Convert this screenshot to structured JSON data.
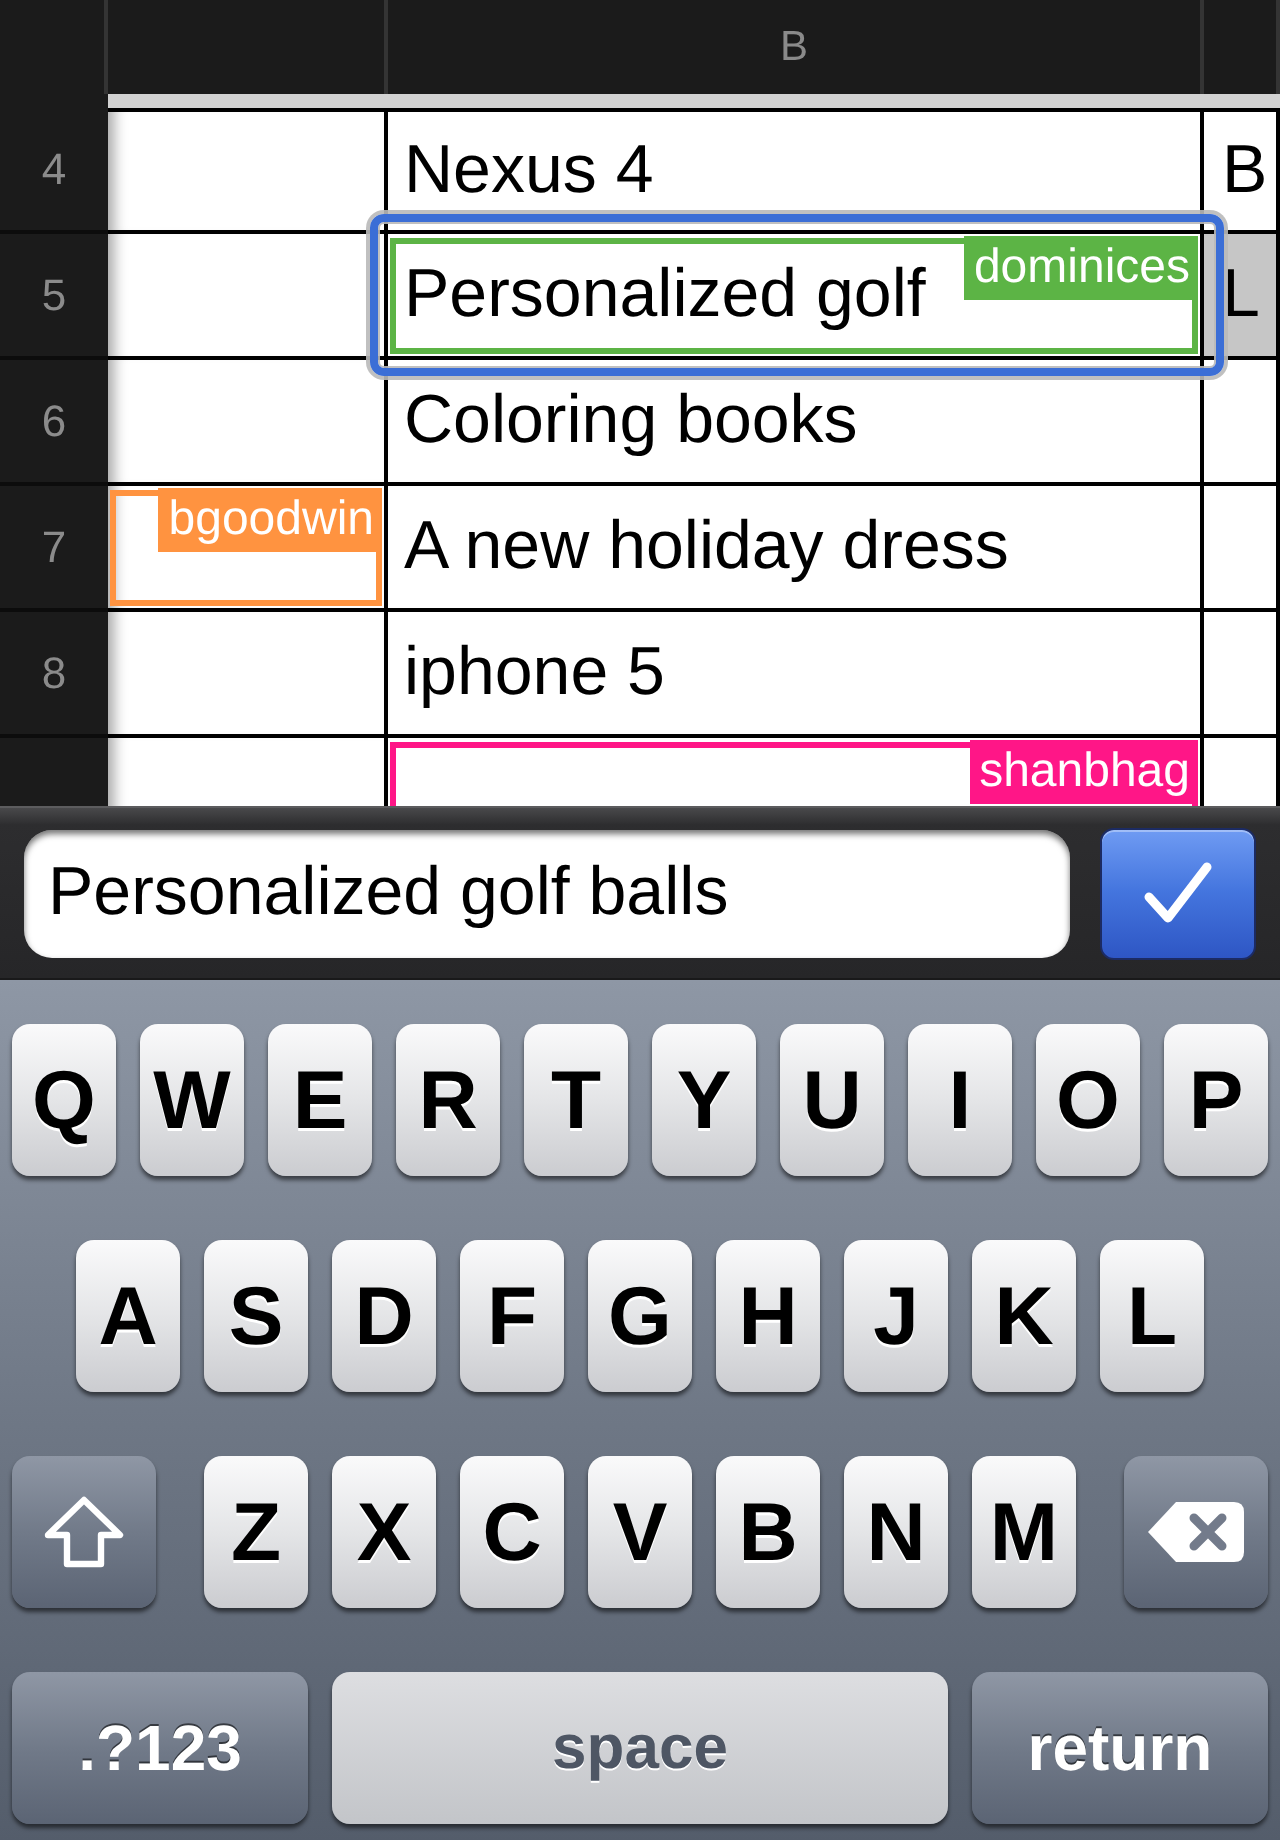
{
  "sheet": {
    "columns": [
      {},
      {
        "label": "B"
      },
      {}
    ],
    "rows": [
      {
        "number": "4",
        "cells": [
          {
            "selected": false,
            "shaded": false
          },
          {
            "text": "Nexus 4",
            "selected": false,
            "shaded": false
          },
          {
            "text": "B",
            "selected": false,
            "shaded": false
          }
        ]
      },
      {
        "number": "5",
        "cells": [
          {
            "selected": false,
            "shaded": false
          },
          {
            "text": "Personalized golf",
            "selected": true,
            "shaded": false,
            "collaborator": {
              "name": "dominices",
              "color": "#5cb445"
            }
          },
          {
            "text": "L",
            "selected": false,
            "shaded": true
          }
        ]
      },
      {
        "number": "6",
        "cells": [
          {
            "selected": false,
            "shaded": false
          },
          {
            "text": "Coloring books",
            "selected": false,
            "shaded": false
          },
          {
            "selected": false,
            "shaded": false
          }
        ]
      },
      {
        "number": "7",
        "cells": [
          {
            "selected": false,
            "shaded": false,
            "collaborator": {
              "name": "bgoodwin",
              "color": "#ff9340"
            }
          },
          {
            "text": "A new holiday dress",
            "selected": false,
            "shaded": false
          },
          {
            "selected": false,
            "shaded": false
          }
        ]
      },
      {
        "number": "8",
        "cells": [
          {
            "selected": false,
            "shaded": false
          },
          {
            "text": "iphone 5",
            "selected": false,
            "shaded": false
          },
          {
            "selected": false,
            "shaded": false
          }
        ]
      },
      {
        "cells": [
          {
            "selected": false,
            "shaded": false
          },
          {
            "selected": false,
            "shaded": false,
            "collaborator": {
              "name": "shanbhag",
              "color": "#ff1687"
            }
          },
          {
            "selected": false,
            "shaded": false
          }
        ]
      }
    ]
  },
  "edit_bar": {
    "value": "Personalized golf balls"
  },
  "keyboard": {
    "rows": [
      {
        "keys": [
          {
            "kind": "letter",
            "label": "Q"
          },
          {
            "kind": "letter",
            "label": "W"
          },
          {
            "kind": "letter",
            "label": "E"
          },
          {
            "kind": "letter",
            "label": "R"
          },
          {
            "kind": "letter",
            "label": "T"
          },
          {
            "kind": "letter",
            "label": "Y"
          },
          {
            "kind": "letter",
            "label": "U"
          },
          {
            "kind": "letter",
            "label": "I"
          },
          {
            "kind": "letter",
            "label": "O"
          },
          {
            "kind": "letter",
            "label": "P"
          }
        ]
      },
      {
        "keys": [
          {
            "kind": "letter",
            "label": "A"
          },
          {
            "kind": "letter",
            "label": "S"
          },
          {
            "kind": "letter",
            "label": "D"
          },
          {
            "kind": "letter",
            "label": "F"
          },
          {
            "kind": "letter",
            "label": "G"
          },
          {
            "kind": "letter",
            "label": "H"
          },
          {
            "kind": "letter",
            "label": "J"
          },
          {
            "kind": "letter",
            "label": "K"
          },
          {
            "kind": "letter",
            "label": "L"
          }
        ]
      },
      {
        "keys": [
          {
            "kind": "shift",
            "on": false
          },
          {
            "kind": "letter",
            "label": "Z"
          },
          {
            "kind": "letter",
            "label": "X"
          },
          {
            "kind": "letter",
            "label": "C"
          },
          {
            "kind": "letter",
            "label": "V"
          },
          {
            "kind": "letter",
            "label": "B"
          },
          {
            "kind": "letter",
            "label": "N"
          },
          {
            "kind": "letter",
            "label": "M"
          },
          {
            "kind": "delete"
          }
        ]
      },
      {
        "keys": [
          {
            "kind": "mode",
            "label": ".?123"
          },
          {
            "kind": "space",
            "label": "space"
          },
          {
            "kind": "return",
            "label": "return"
          }
        ]
      }
    ]
  }
}
